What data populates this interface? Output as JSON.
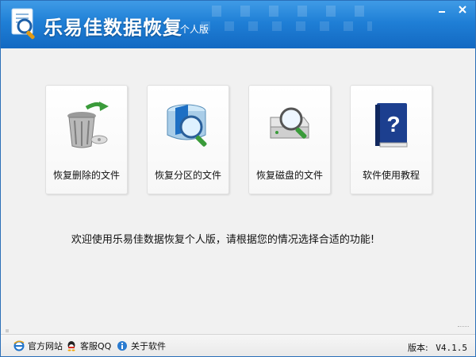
{
  "titlebar": {
    "title": "乐易佳数据恢复",
    "edition": "个人版",
    "minimize_icon": "minimize-icon",
    "close_icon": "close-icon"
  },
  "actions": [
    {
      "label": "恢复删除的文件",
      "icon": "recycle-bin-icon"
    },
    {
      "label": "恢复分区的文件",
      "icon": "partition-search-icon"
    },
    {
      "label": "恢复磁盘的文件",
      "icon": "disk-search-icon"
    },
    {
      "label": "软件使用教程",
      "icon": "help-book-icon"
    }
  ],
  "welcome_text": "欢迎使用乐易佳数据恢复个人版，请根据您的情况选择合适的功能!",
  "statusbar": {
    "website_label": "官方网站",
    "qq_label": "客服QQ",
    "about_label": "关于软件",
    "version_label": "版本:",
    "version_value": "V4.1.5"
  },
  "colors": {
    "titlebar": "#1f7fd6",
    "background": "#f1f1f1",
    "text": "#111111"
  }
}
